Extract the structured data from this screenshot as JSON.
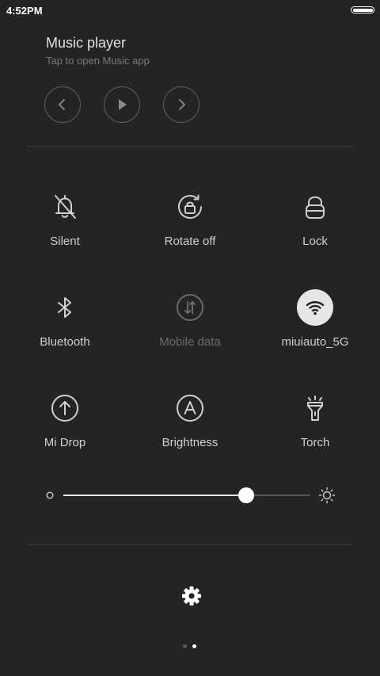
{
  "status_bar": {
    "time": "4:52PM"
  },
  "music_player": {
    "title": "Music player",
    "subtitle": "Tap to open Music app",
    "previous_icon": "chevron-left-icon",
    "play_icon": "play-icon",
    "next_icon": "chevron-right-icon"
  },
  "toggles": [
    {
      "label": "Silent",
      "icon": "bell-off-icon",
      "state": "off"
    },
    {
      "label": "Rotate off",
      "icon": "rotate-lock-icon",
      "state": "off"
    },
    {
      "label": "Lock",
      "icon": "lock-icon",
      "state": "off"
    },
    {
      "label": "Bluetooth",
      "icon": "bluetooth-icon",
      "state": "off"
    },
    {
      "label": "Mobile data",
      "icon": "mobile-data-icon",
      "state": "disabled"
    },
    {
      "label": "miuiauto_5G",
      "icon": "wifi-icon",
      "state": "on"
    },
    {
      "label": "Mi Drop",
      "icon": "mi-drop-icon",
      "state": "off"
    },
    {
      "label": "Brightness",
      "icon": "auto-brightness-icon",
      "state": "off"
    },
    {
      "label": "Torch",
      "icon": "torch-icon",
      "state": "off"
    }
  ],
  "brightness": {
    "level_fraction": 0.74
  },
  "settings_icon": "gear-icon",
  "pagination": {
    "pages": 2,
    "current": 2
  },
  "colors": {
    "background": "#242424",
    "active_toggle": "#e6e6e6",
    "disabled_text": "#6a6a6a"
  }
}
